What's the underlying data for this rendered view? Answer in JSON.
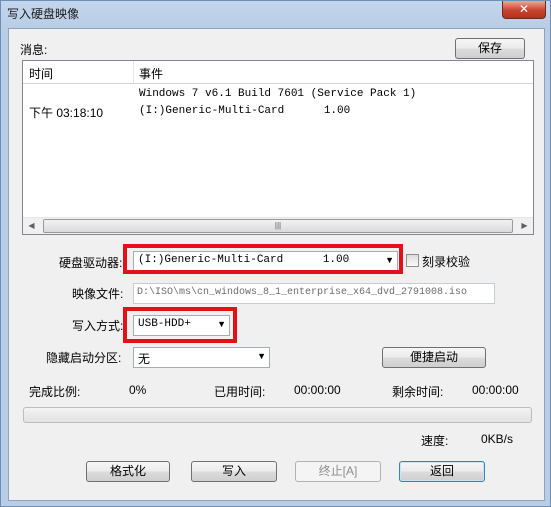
{
  "window": {
    "title": "写入硬盘映像",
    "close_glyph": "✕"
  },
  "messages": {
    "label": "消息:",
    "save_button": "保存",
    "columns": [
      "时间",
      "事件"
    ],
    "rows": [
      {
        "time": "",
        "event": "Windows 7 v6.1 Build 7601 (Service Pack 1)"
      },
      {
        "time": "下午 03:18:10",
        "event": "(I:)Generic-Multi-Card      1.00"
      }
    ],
    "scroll_thumb_grip": "|||"
  },
  "drive": {
    "label": "硬盘驱动器:",
    "value": "(I:)Generic-Multi-Card      1.00",
    "verify_label": "刻录校验",
    "verify_checked": false
  },
  "image_file": {
    "label": "映像文件:",
    "value": "D:\\ISO\\ms\\cn_windows_8_1_enterprise_x64_dvd_2791008.iso"
  },
  "write_method": {
    "label": "写入方式:",
    "value": "USB-HDD+"
  },
  "hidden_partition": {
    "label": "隐藏启动分区:",
    "value": "无",
    "quick_boot_button": "便捷启动"
  },
  "progress": {
    "ratio_label": "完成比例:",
    "ratio_value": "0%",
    "elapsed_label": "已用时间:",
    "elapsed_value": "00:00:00",
    "remaining_label": "剩余时间:",
    "remaining_value": "00:00:00",
    "fraction": 0,
    "speed_label": "速度:",
    "speed_value": "0KB/s"
  },
  "buttons": {
    "format": "格式化",
    "write": "写入",
    "abort": "终止[A]",
    "back": "返回"
  },
  "colors": {
    "highlight_box": "#e3101a",
    "title_bar": "#c4d6ec",
    "close_button": "#c7432c"
  }
}
